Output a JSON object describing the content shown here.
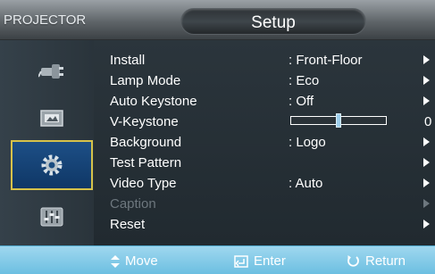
{
  "header": {
    "brand": "PROJECTOR",
    "title": "Setup"
  },
  "sidebar": {
    "items": [
      {
        "icon": "input-plug-icon",
        "selected": false
      },
      {
        "icon": "picture-icon",
        "selected": false
      },
      {
        "icon": "setup-gear-icon",
        "selected": true
      },
      {
        "icon": "option-sliders-icon",
        "selected": false
      }
    ]
  },
  "menu": {
    "rows": [
      {
        "label": "Install",
        "value": ": Front-Floor",
        "arrow": true,
        "enabled": true
      },
      {
        "label": "Lamp Mode",
        "value": ": Eco",
        "arrow": true,
        "enabled": true
      },
      {
        "label": "Auto Keystone",
        "value": ": Off",
        "arrow": true,
        "enabled": true
      },
      {
        "label": "V-Keystone",
        "value": "0",
        "enabled": true
      },
      {
        "label": "Background",
        "value": ": Logo",
        "arrow": true,
        "enabled": true
      },
      {
        "label": "Test Pattern",
        "value": "",
        "arrow": true,
        "enabled": true
      },
      {
        "label": "Video Type",
        "value": ": Auto",
        "arrow": true,
        "enabled": true
      },
      {
        "label": "Caption",
        "value": "",
        "arrow": true,
        "enabled": false
      },
      {
        "label": "Reset",
        "value": "",
        "arrow": true,
        "enabled": true
      }
    ],
    "keystone_slider": {
      "level_fraction": 0.5
    }
  },
  "footer": {
    "move": "Move",
    "enter": "Enter",
    "return": "Return"
  },
  "colors": {
    "panel": "#2b353c",
    "footer": "#8dcfeb",
    "selected_border": "#d6c24a",
    "selected_fill": "#1d4f86",
    "disabled_text": "#6d777e"
  }
}
